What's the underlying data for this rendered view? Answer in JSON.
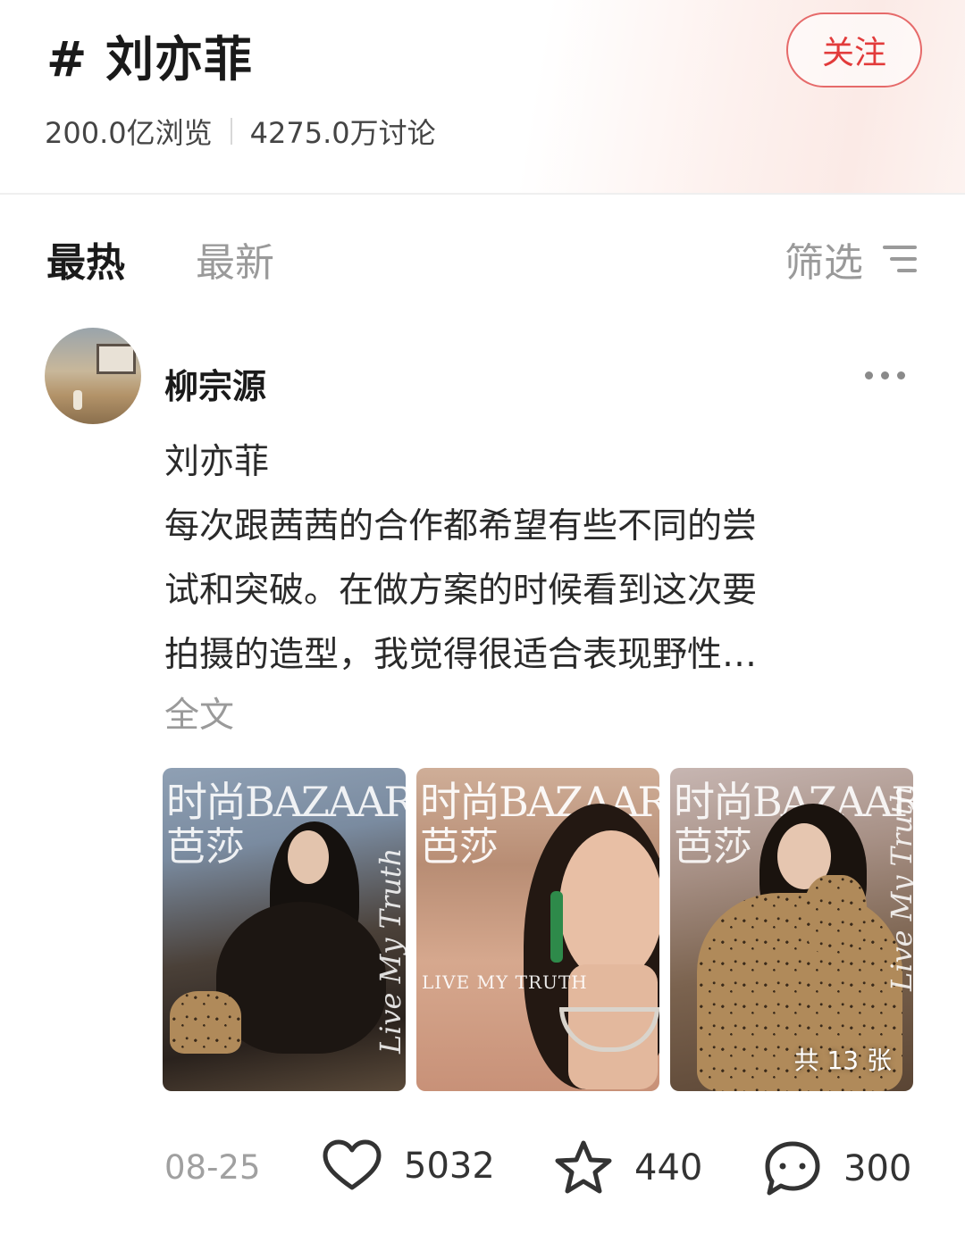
{
  "header": {
    "topic_title": "# 刘亦菲",
    "follow_label": "关注",
    "views": "200.0亿浏览",
    "discussions": "4275.0万讨论"
  },
  "tabs": {
    "hot": "最热",
    "latest": "最新",
    "filter": "筛选"
  },
  "post": {
    "username": "柳宗源",
    "text_lines": [
      "刘亦菲",
      "每次跟茜茜的合作都希望有些不同的尝",
      "试和突破。在做方案的时候看到这次要",
      "拍摄的造型，我觉得很适合表现野性…"
    ],
    "full_text_label": "全文",
    "images": [
      {
        "mag_title": "时尚BAZAAR",
        "mag_sub": "芭莎",
        "cover_line": "Live My Truth"
      },
      {
        "mag_title": "时尚BAZAAR",
        "mag_sub": "芭莎",
        "cover_line": "LIVE MY TRUTH"
      },
      {
        "mag_title": "时尚BAZAAR",
        "mag_sub": "芭莎",
        "cover_line": "Live My Truth",
        "count_badge": "共 13 张"
      }
    ],
    "date": "08-25",
    "likes": "5032",
    "favorites": "440",
    "comments": "300"
  },
  "colors": {
    "accent_red": "#e23b3b",
    "text_primary": "#1a1a1a",
    "text_muted": "#9a9a9a"
  },
  "icons": {
    "filter": "filter-lines-icon",
    "more": "more-dots-icon",
    "like": "heart-icon",
    "favorite": "star-icon",
    "comment": "comment-bubble-icon"
  }
}
